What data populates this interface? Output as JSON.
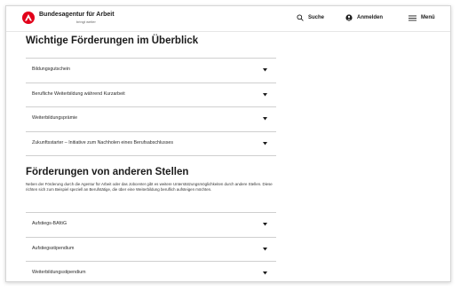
{
  "header": {
    "brand_name": "Bundesagentur für Arbeit",
    "brand_tagline": "bringt weiter",
    "search_label": "Suche",
    "login_label": "Anmelden",
    "menu_label": "Menü",
    "brand_color": "#e2001a"
  },
  "section1": {
    "title": "Wichtige Förderungen im Überblick",
    "items": [
      {
        "label": "Bildungsgutschein"
      },
      {
        "label": "Berufliche Weiterbildung während Kurzarbeit"
      },
      {
        "label": "Weiterbildungsprämie"
      },
      {
        "label": "Zukunftsstarter – Initiative zum Nachholen eines Berufsabschlusses"
      }
    ]
  },
  "section2": {
    "title": "Förderungen von anderen Stellen",
    "intro": "Neben der Förderung durch die Agentur für Arbeit oder das Jobcenter gibt es weitere Unterstützungsmöglichkeiten durch andere Stellen. Diese richten sich zum Beispiel speziell an Berufstätige, die über eine Weiterbildung beruflich aufsteigen möchten.",
    "items": [
      {
        "label": "Aufstiegs-BAföG"
      },
      {
        "label": "Aufstiegsstipendium"
      },
      {
        "label": "Weiterbildungsstipendium"
      }
    ]
  },
  "icons": {
    "chevron": "chevron-down-icon",
    "search": "search-icon",
    "user": "user-icon",
    "menu": "hamburger-menu-icon"
  }
}
